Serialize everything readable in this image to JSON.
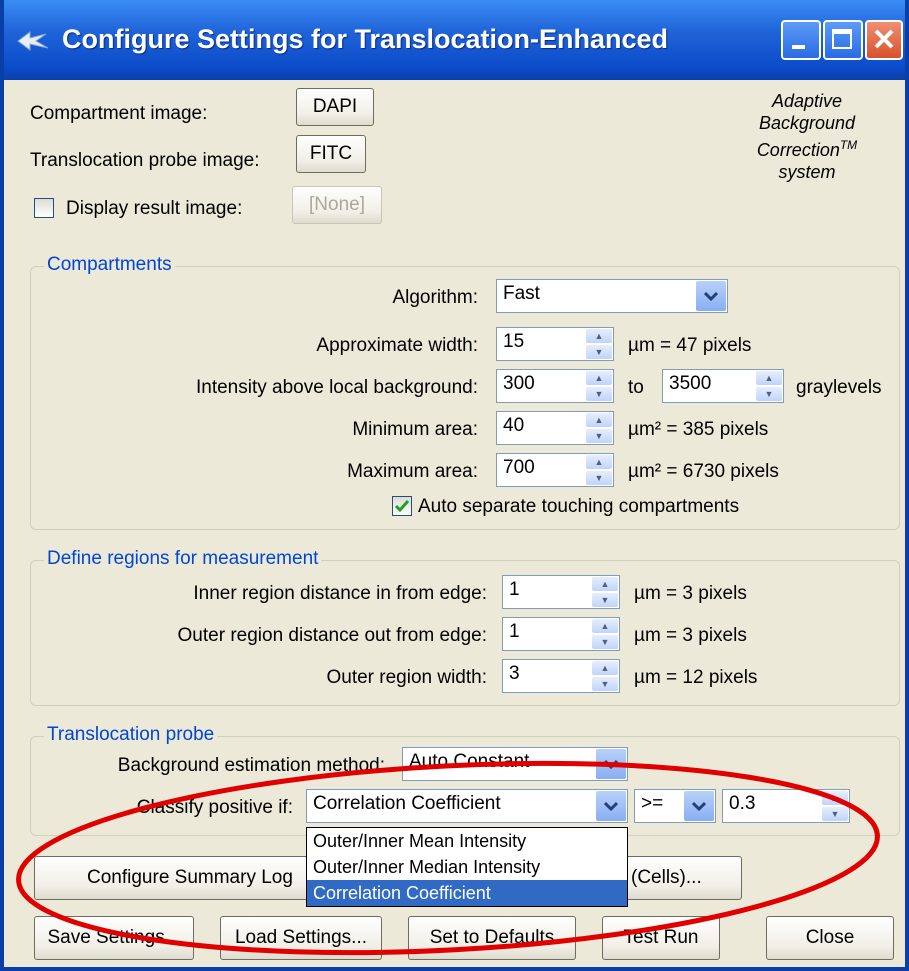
{
  "window": {
    "title": "Configure Settings for Translocation-Enhanced"
  },
  "images": {
    "compartment_label": "Compartment image:",
    "compartment_value": "DAPI",
    "translocation_label": "Translocation probe image:",
    "translocation_value": "FITC",
    "display_result_label": "Display result image:",
    "display_result_value": "[None]",
    "display_result_checked": false
  },
  "logo_text": {
    "line1": "Adaptive",
    "line2": "Background",
    "line3": "Correction",
    "line3_sup": "TM",
    "line4": "system"
  },
  "compartments": {
    "legend": "Compartments",
    "algorithm_label": "Algorithm:",
    "algorithm_value": "Fast",
    "width_label": "Approximate width:",
    "width_value": "15",
    "width_unit": "µm = 47 pixels",
    "intensity_label": "Intensity above local background:",
    "intensity_value": "300",
    "intensity_to": "to",
    "intensity_max": "3500",
    "intensity_unit": "graylevels",
    "min_area_label": "Minimum area:",
    "min_area_value": "40",
    "min_area_unit": "µm² = 385 pixels",
    "max_area_label": "Maximum area:",
    "max_area_value": "700",
    "max_area_unit": "µm² = 6730 pixels",
    "auto_separate_label": "Auto separate touching compartments",
    "auto_separate_checked": true
  },
  "regions": {
    "legend": "Define regions for measurement",
    "inner_label": "Inner region distance in from edge:",
    "inner_value": "1",
    "inner_unit": "µm = 3 pixels",
    "outer_label": "Outer region distance out from edge:",
    "outer_value": "1",
    "outer_unit": "µm = 3 pixels",
    "width_label": "Outer region width:",
    "width_value": "3",
    "width_unit": "µm = 12 pixels"
  },
  "probe": {
    "legend": "Translocation probe",
    "bg_label": "Background estimation method:",
    "bg_value": "Auto Constant",
    "classify_label": "Classify positive if:",
    "classify_value": "Correlation Coefficient",
    "operator_value": ">=",
    "threshold_value": "0.3",
    "options": [
      "Outer/Inner Mean Intensity",
      "Outer/Inner Median Intensity",
      "Correlation Coefficient"
    ],
    "selected_option_index": 2
  },
  "buttons": {
    "configure_summary": "Configure Summary Log",
    "cells_partial": "(Cells)...",
    "save": "Save Settings...",
    "load": "Load Settings...",
    "defaults": "Set to Defaults",
    "test_run": "Test Run",
    "close": "Close"
  },
  "colors": {
    "titlebar": "#0b4cc9",
    "legend_text": "#0046d5",
    "selection": "#316ac5",
    "annotation_ellipse": "#e00000"
  }
}
